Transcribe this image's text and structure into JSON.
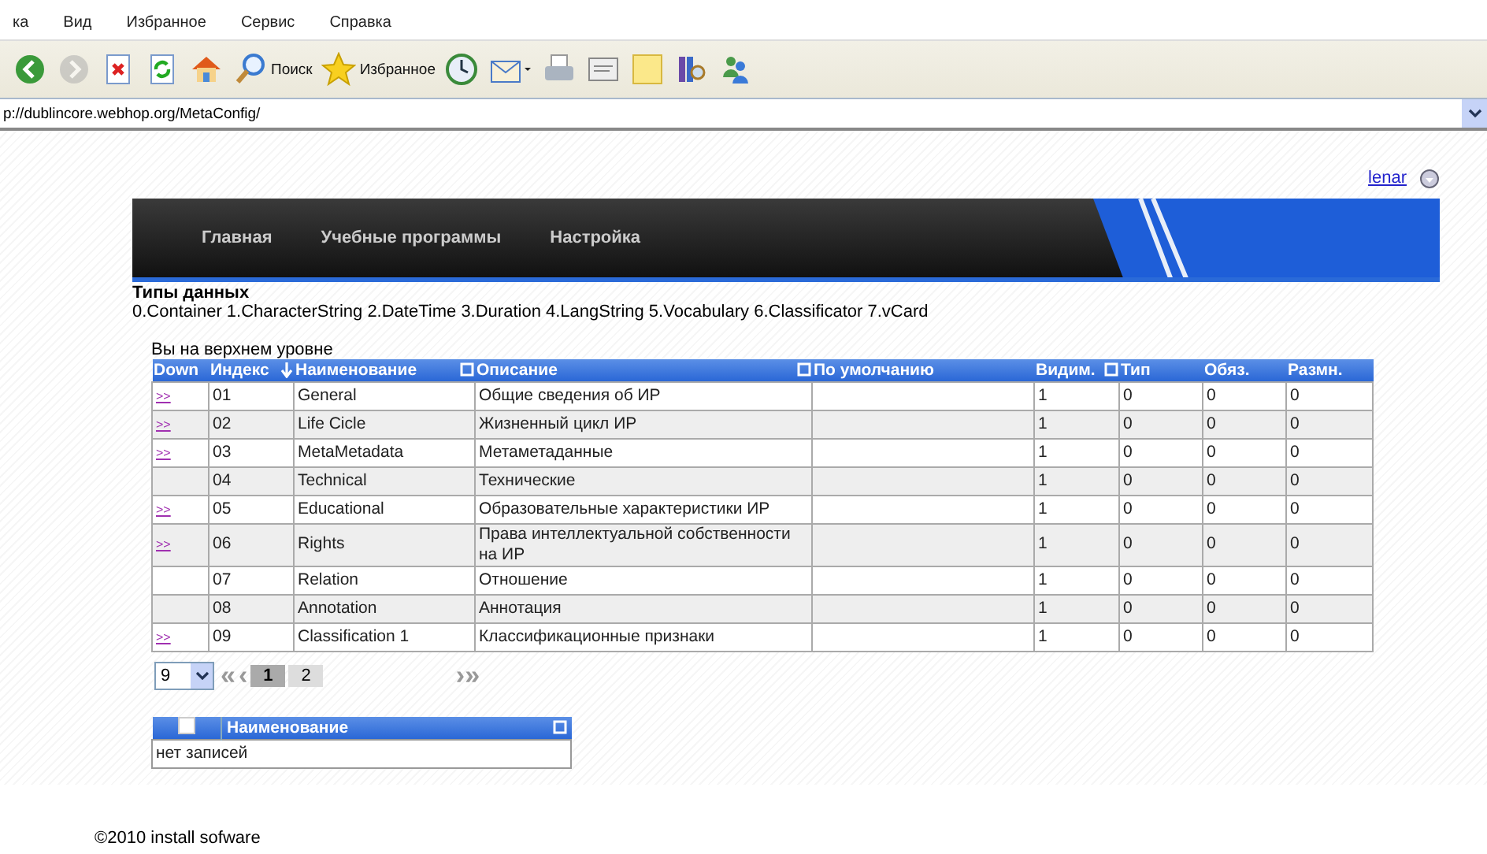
{
  "browser": {
    "menu": [
      "ка",
      "Вид",
      "Избранное",
      "Сервис",
      "Справка"
    ],
    "toolbar": [
      {
        "kind": "back"
      },
      {
        "kind": "forward",
        "disabled": true
      },
      {
        "kind": "stop"
      },
      {
        "kind": "refresh"
      },
      {
        "kind": "home"
      },
      {
        "kind": "search",
        "label": "Поиск"
      },
      {
        "kind": "favorites",
        "label": "Избранное"
      },
      {
        "kind": "history"
      },
      {
        "kind": "mail"
      },
      {
        "kind": "print"
      },
      {
        "kind": "edit"
      },
      {
        "kind": "note"
      },
      {
        "kind": "research"
      },
      {
        "kind": "messenger"
      }
    ],
    "address": "p://dublincore.webhop.org/MetaConfig/"
  },
  "user_link": "lenar",
  "nav": [
    "Главная",
    "Учебные программы",
    "Настройка"
  ],
  "data_types": {
    "title": "Типы данных",
    "list": "0.Container 1.CharacterString 2.DateTime 3.Duration 4.LangString 5.Vocabulary 6.Classificator 7.vCard"
  },
  "level_text": "Вы на верхнем уровне",
  "table": {
    "columns": [
      {
        "label": "Down",
        "filter": false,
        "sorted": false
      },
      {
        "label": "Индекс",
        "filter": false,
        "sorted": true
      },
      {
        "label": "Наименование",
        "filter": true,
        "sorted": false
      },
      {
        "label": "Описание",
        "filter": true,
        "sorted": false
      },
      {
        "label": "По умолчанию",
        "filter": false,
        "sorted": false
      },
      {
        "label": "Видим.",
        "filter": true,
        "sorted": false
      },
      {
        "label": "Тип",
        "filter": false,
        "sorted": false
      },
      {
        "label": "Обяз.",
        "filter": false,
        "sorted": false
      },
      {
        "label": "Размн.",
        "filter": false,
        "sorted": false
      }
    ],
    "rows": [
      {
        "cells": [
          ">>",
          "01",
          "General",
          "Общие сведения об ИР",
          "",
          "1",
          "0",
          "0",
          "0"
        ]
      },
      {
        "cells": [
          ">>",
          "02",
          "Life Cicle",
          "Жизненный цикл ИР",
          "",
          "1",
          "0",
          "0",
          "0"
        ]
      },
      {
        "cells": [
          ">>",
          "03",
          "MetaMetadata",
          "Метаметаданные",
          "",
          "1",
          "0",
          "0",
          "0"
        ]
      },
      {
        "cells": [
          "",
          "04",
          "Technical",
          "Технические",
          "",
          "1",
          "0",
          "0",
          "0"
        ]
      },
      {
        "cells": [
          ">>",
          "05",
          "Educational",
          "Образовательные характеристики ИР",
          "",
          "1",
          "0",
          "0",
          "0"
        ]
      },
      {
        "cells": [
          ">>",
          "06",
          "Rights",
          "Права интеллектуальной собственности на ИР",
          "",
          "1",
          "0",
          "0",
          "0"
        ]
      },
      {
        "cells": [
          "",
          "07",
          "Relation",
          "Отношение",
          "",
          "1",
          "0",
          "0",
          "0"
        ]
      },
      {
        "cells": [
          "",
          "08",
          "Annotation",
          "Аннотация",
          "",
          "1",
          "0",
          "0",
          "0"
        ]
      },
      {
        "cells": [
          ">>",
          "09",
          "Classification 1",
          "Классификационные признаки",
          "",
          "1",
          "0",
          "0",
          "0"
        ]
      }
    ]
  },
  "pager": {
    "page_size": "9",
    "first": "«",
    "prev": "‹",
    "pages": [
      {
        "label": "1",
        "selected": true
      },
      {
        "label": "2",
        "selected": false
      }
    ],
    "next": "›",
    "last": "»"
  },
  "sub_table": {
    "checked": false,
    "column": "Наименование",
    "empty_text": "нет записей"
  },
  "footer": "©2010 install sofware"
}
